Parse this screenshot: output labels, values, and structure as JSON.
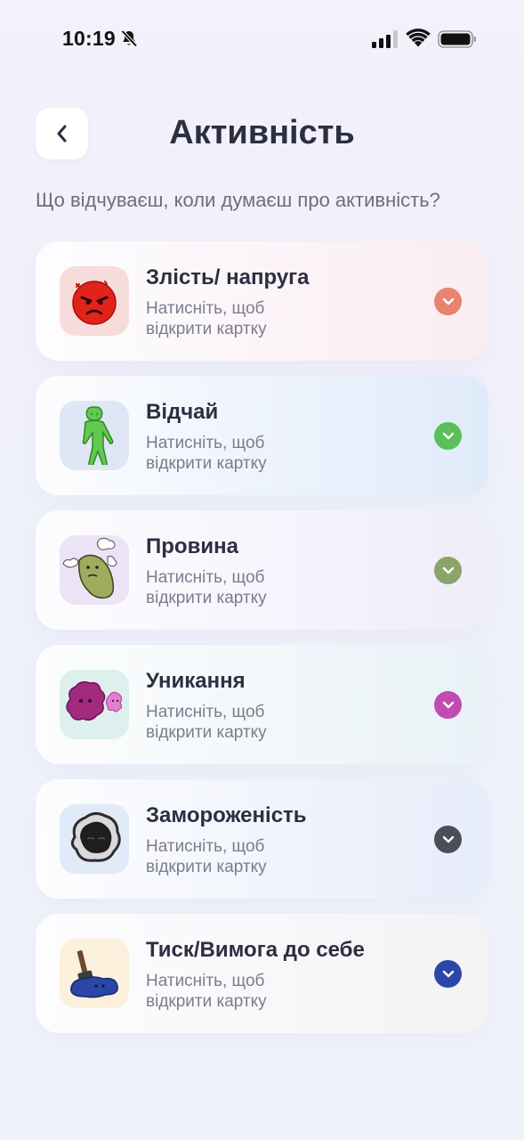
{
  "status_bar": {
    "time": "10:19",
    "icons": [
      "bell-slash-icon",
      "cellular-signal-icon",
      "wifi-icon",
      "battery-icon"
    ]
  },
  "header": {
    "back_icon": "chevron-left-icon",
    "title": "Активність"
  },
  "subtitle": "Що відчуваєш, коли думаєш про активність?",
  "cards": [
    {
      "title": "Злість/ напруга",
      "hint": "Натисніть, щоб відкрити картку",
      "icon": "angry-face-icon",
      "tile_color": "#f7dcdc",
      "accent": "#e9826f"
    },
    {
      "title": "Відчай",
      "hint": "Натисніть, щоб відкрити картку",
      "icon": "green-figure-icon",
      "tile_color": "#dfe6f6",
      "accent": "#5cbf5a"
    },
    {
      "title": "Провина",
      "hint": "Натисніть, щоб відкрити картку",
      "icon": "pickle-creature-icon",
      "tile_color": "#ece4f6",
      "accent": "#8aa46a"
    },
    {
      "title": "Уникання",
      "hint": "Натисніть, щоб відкрити картку",
      "icon": "pink-blob-icon",
      "tile_color": "#ddf0ee",
      "accent": "#c24bb1"
    },
    {
      "title": "Замороженість",
      "hint": "Натисніть, щоб відкрити картку",
      "icon": "dark-blob-icon",
      "tile_color": "#e0eaf8",
      "accent": "#4a4e58"
    },
    {
      "title": "Тиск/Вимога до себе",
      "hint": "Натисніть, щоб відкрити картку",
      "icon": "hammer-puddle-icon",
      "tile_color": "#fbf0dc",
      "accent": "#2d46a6"
    }
  ]
}
